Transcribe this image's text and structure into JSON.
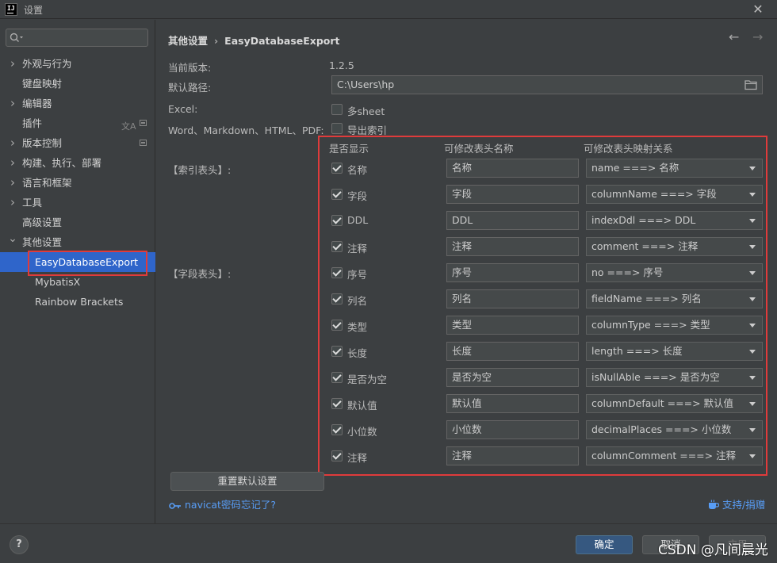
{
  "window": {
    "title": "设置",
    "app_icon_text": "IJ"
  },
  "sidebar": {
    "search_placeholder": "",
    "items": [
      {
        "label": "外观与行为",
        "expandable": true,
        "expanded": false
      },
      {
        "label": "键盘映射",
        "expandable": false
      },
      {
        "label": "编辑器",
        "expandable": true,
        "expanded": false
      },
      {
        "label": "插件",
        "expandable": false
      },
      {
        "label": "版本控制",
        "expandable": true,
        "expanded": false
      },
      {
        "label": "构建、执行、部署",
        "expandable": true,
        "expanded": false
      },
      {
        "label": "语言和框架",
        "expandable": true,
        "expanded": false
      },
      {
        "label": "工具",
        "expandable": true,
        "expanded": false
      },
      {
        "label": "高级设置",
        "expandable": false
      },
      {
        "label": "其他设置",
        "expandable": true,
        "expanded": true
      },
      {
        "label": "EasyDatabaseExport",
        "child": true,
        "selected": true
      },
      {
        "label": "MybatisX",
        "child": true
      },
      {
        "label": "Rainbow Brackets",
        "child": true
      }
    ]
  },
  "breadcrumb": {
    "parent": "其他设置",
    "current": "EasyDatabaseExport"
  },
  "form": {
    "version_label": "当前版本:",
    "version_value": "1.2.5",
    "path_label": "默认路径:",
    "path_value": "C:\\Users\\hp",
    "excel_label": "Excel:",
    "excel_option": "多sheet",
    "excel_checked": false,
    "word_label": "Word、Markdown、HTML、PDF:",
    "word_option": "导出索引",
    "word_checked": false
  },
  "table": {
    "col_show": "是否显示",
    "col_name": "可修改表头名称",
    "col_mapping": "可修改表头映射关系",
    "index_section_label": "【索引表头】:",
    "field_section_label": "【字段表头】:",
    "rows": [
      {
        "label": "名称",
        "checked": true,
        "name": "名称",
        "mapping": "name ===> 名称"
      },
      {
        "label": "字段",
        "checked": true,
        "name": "字段",
        "mapping": "columnName ===> 字段"
      },
      {
        "label": "DDL",
        "checked": true,
        "name": "DDL",
        "mapping": "indexDdl ===> DDL"
      },
      {
        "label": "注释",
        "checked": true,
        "name": "注释",
        "mapping": "comment ===> 注释"
      },
      {
        "label": "序号",
        "checked": true,
        "name": "序号",
        "mapping": "no ===> 序号"
      },
      {
        "label": "列名",
        "checked": true,
        "name": "列名",
        "mapping": "fieldName ===> 列名"
      },
      {
        "label": "类型",
        "checked": true,
        "name": "类型",
        "mapping": "columnType ===> 类型"
      },
      {
        "label": "长度",
        "checked": true,
        "name": "长度",
        "mapping": "length ===> 长度"
      },
      {
        "label": "是否为空",
        "checked": true,
        "name": "是否为空",
        "mapping": "isNullAble ===> 是否为空"
      },
      {
        "label": "默认值",
        "checked": true,
        "name": "默认值",
        "mapping": "columnDefault ===> 默认值"
      },
      {
        "label": "小位数",
        "checked": true,
        "name": "小位数",
        "mapping": "decimalPlaces ===> 小位数"
      },
      {
        "label": "注释",
        "checked": true,
        "name": "注释",
        "mapping": "columnComment ===> 注释"
      }
    ]
  },
  "actions": {
    "reset_label": "重置默认设置",
    "navicat_link": "navicat密码忘记了?",
    "support_link": "支持/捐赠"
  },
  "footer": {
    "help_label": "?",
    "ok_label": "确定",
    "cancel_label": "取消",
    "apply_label": "应用",
    "watermark": "CSDN @凡间晨光"
  },
  "colors": {
    "accent": "#2f65ca",
    "highlight_box": "#e03b3b",
    "link": "#589df6"
  }
}
